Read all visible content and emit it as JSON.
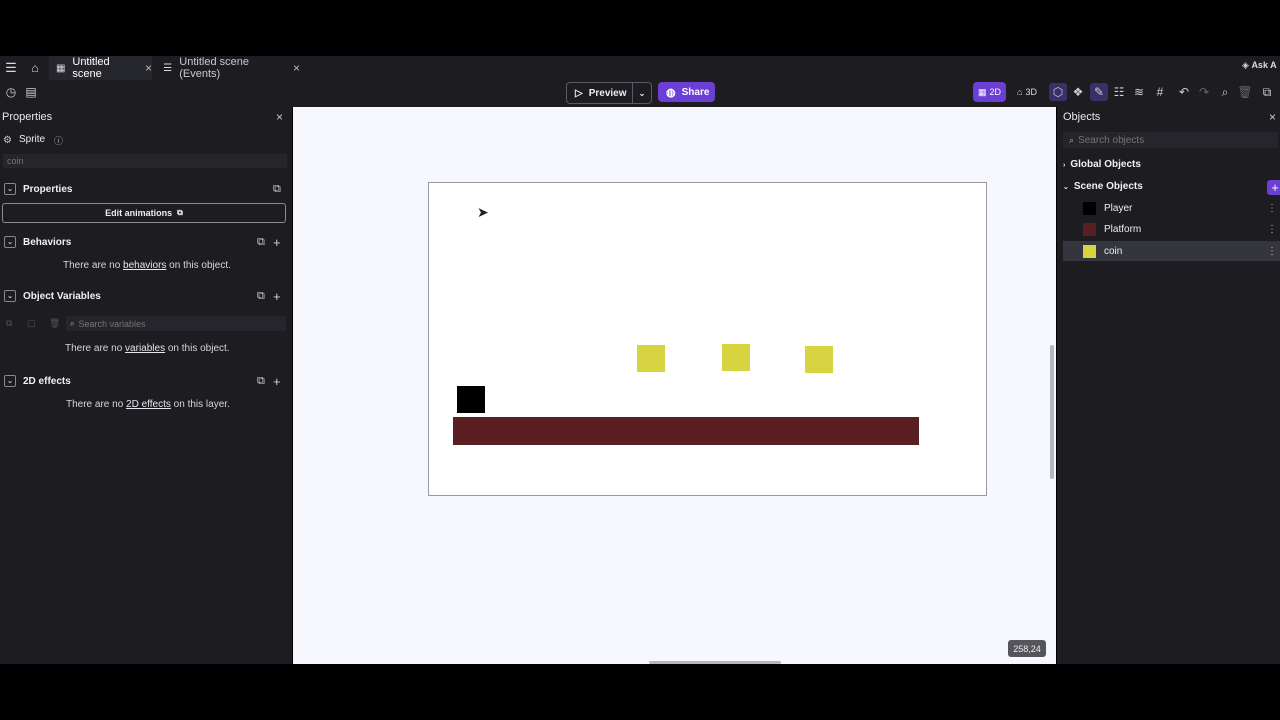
{
  "tabs": [
    {
      "label": "Untitled scene",
      "active": true
    },
    {
      "label": "Untitled scene (Events)",
      "active": false
    }
  ],
  "top_right": {
    "ask_label": "Ask A"
  },
  "toolbar": {
    "preview_label": "Preview",
    "share_label": "Share",
    "mode_2d": "2D",
    "mode_3d": "3D"
  },
  "properties_panel": {
    "title": "Properties",
    "object_type": "Sprite",
    "object_name_placeholder": "coin",
    "sections": {
      "properties": "Properties",
      "edit_animations": "Edit animations",
      "behaviors": "Behaviors",
      "object_variables": "Object Variables",
      "effects": "2D effects"
    },
    "behaviors_note": {
      "before": "There are no ",
      "link": "behaviors",
      "after": " on this object."
    },
    "variables_search_placeholder": "Search variables",
    "variables_note": {
      "before": "There are no ",
      "link": "variables",
      "after": " on this object."
    },
    "effects_note": {
      "before": "There are no ",
      "link": "2D effects",
      "after": " on this layer."
    }
  },
  "objects_panel": {
    "title": "Objects",
    "search_placeholder": "Search objects",
    "global_group": "Global Objects",
    "scene_group": "Scene Objects",
    "items": [
      {
        "name": "Player",
        "color": "#000000",
        "selected": false
      },
      {
        "name": "Platform",
        "color": "#5a1f22",
        "selected": false
      },
      {
        "name": "coin",
        "color": "#d8d340",
        "selected": true
      }
    ]
  },
  "canvas": {
    "coords_readout": "258,24",
    "colors": {
      "player": "#000000",
      "platform": "#5a1f22",
      "coin": "#d8d340",
      "accent": "#6b3fd4"
    }
  }
}
